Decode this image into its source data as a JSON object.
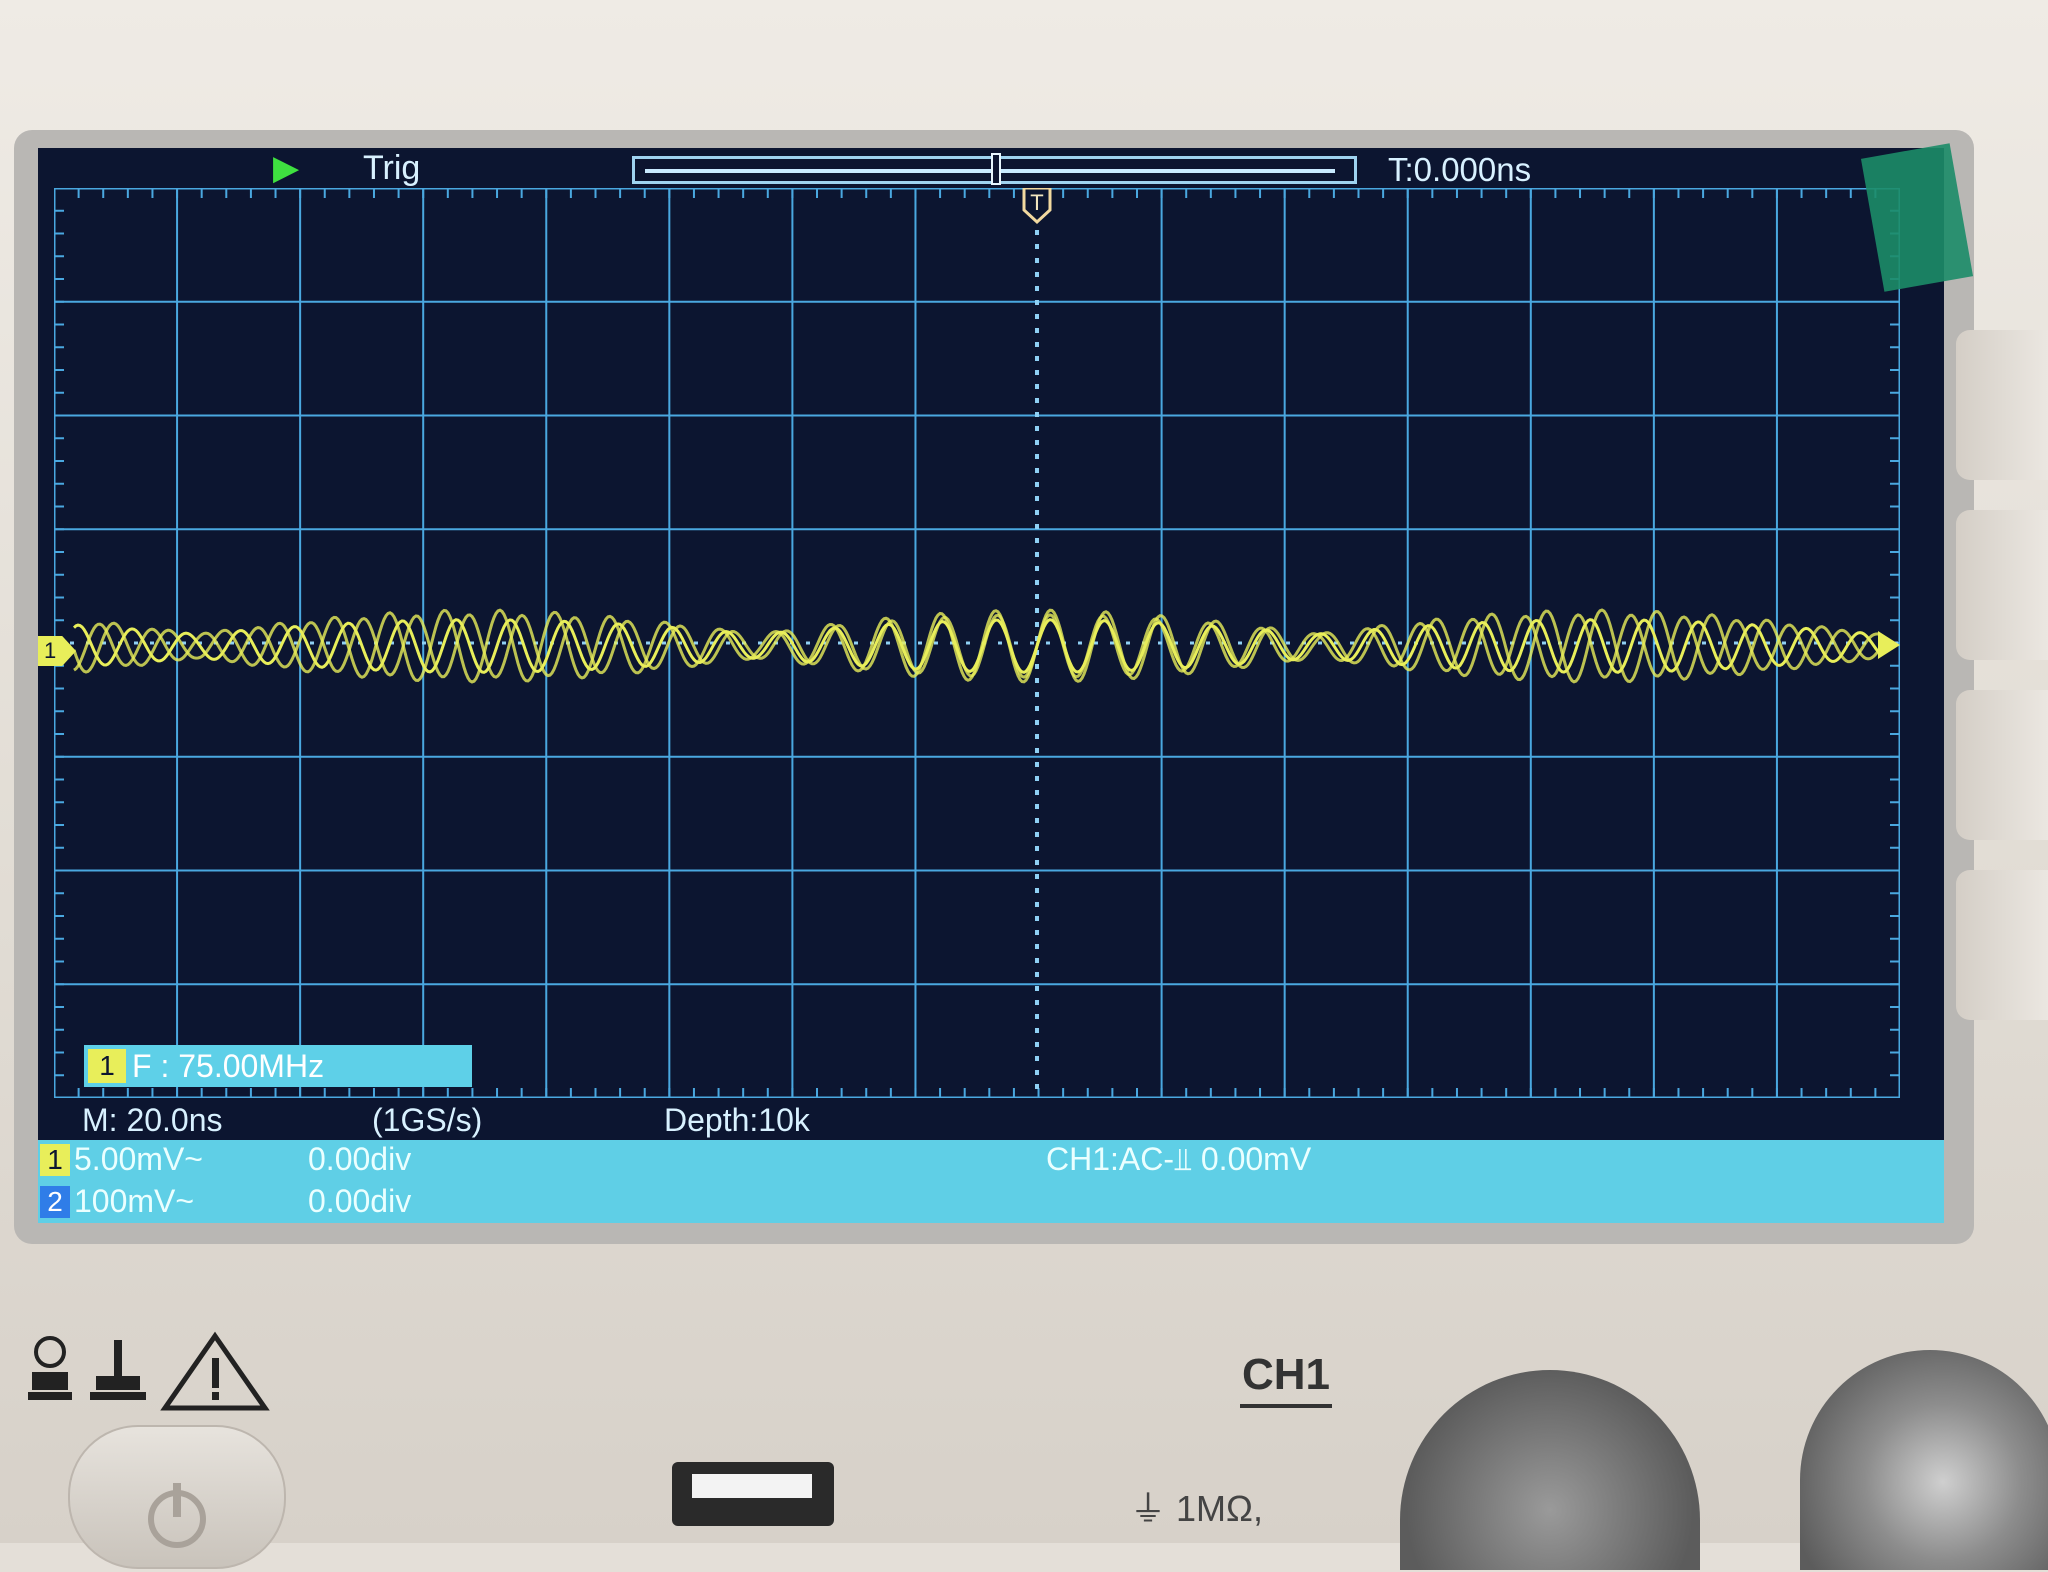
{
  "scope": {
    "top_bar": {
      "trigger_state": "Trig",
      "time_offset": "T:0.000ns"
    },
    "measurement": {
      "channel": "1",
      "text": "F : 75.00MHz"
    },
    "info": {
      "timebase": "M: 20.0ns",
      "sample_rate": "(1GS/s)",
      "depth": "Depth:10k"
    },
    "channels": [
      {
        "num": "1",
        "scale": "5.00mV~",
        "offset": "0.00div"
      },
      {
        "num": "2",
        "scale": "100mV~",
        "offset": "0.00div"
      }
    ],
    "trigger_info": "CH1:AC-⫫ 0.00mV",
    "channel1_marker": "1",
    "trigger_marker": "T",
    "colors": {
      "trace": "#e8ee5a",
      "grid": "#4aa8e0",
      "background": "#0c1530",
      "status": "#5fcfe6"
    }
  },
  "panel": {
    "channel_label": "CH1",
    "impedance": "1MΩ,"
  }
}
